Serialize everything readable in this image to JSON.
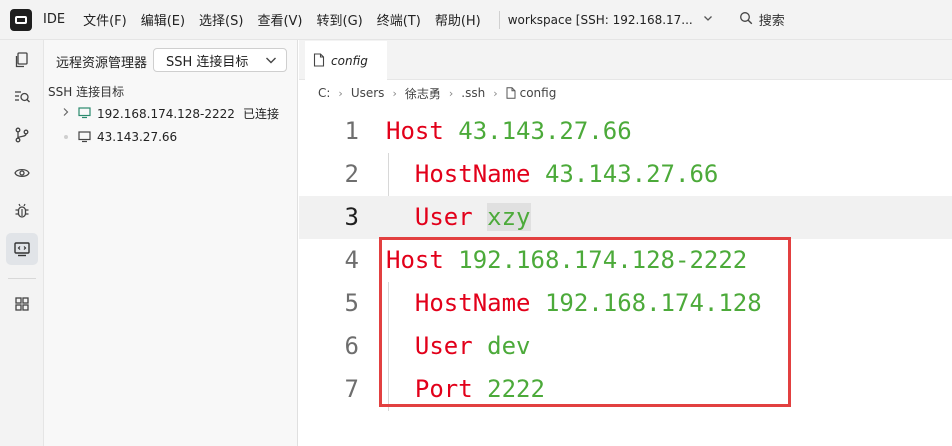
{
  "menubar": {
    "app_name": "IDE",
    "items": [
      "文件(F)",
      "编辑(E)",
      "选择(S)",
      "查看(V)",
      "转到(G)",
      "终端(T)",
      "帮助(H)"
    ],
    "workspace": "workspace [SSH: 192.168.17...",
    "search_label": "搜索"
  },
  "activity_bar": {
    "icons": [
      "explorer-icon",
      "search-icon",
      "source-control-icon",
      "remote-icon",
      "debug-icon",
      "remote-explorer-icon",
      "extensions-icon"
    ],
    "active": "remote-explorer-icon"
  },
  "sidebar": {
    "title": "远程资源管理器",
    "dropdown_value": "SSH 连接目标",
    "section_label": "SSH 连接目标",
    "hosts": [
      {
        "label": "192.168.174.128-2222",
        "status": "已连接"
      },
      {
        "label": "43.143.27.66",
        "status": ""
      }
    ]
  },
  "editor": {
    "tab_label": "config",
    "breadcrumb": [
      "C:",
      "Users",
      "徐志勇",
      ".ssh",
      "config"
    ],
    "lines": [
      {
        "num": "1",
        "key": "Host",
        "value": "43.143.27.66"
      },
      {
        "num": "2",
        "key": "HostName",
        "value": "43.143.27.66"
      },
      {
        "num": "3",
        "key": "User",
        "value": "xzy"
      },
      {
        "num": "4",
        "key": "Host",
        "value": "192.168.174.128-2222"
      },
      {
        "num": "5",
        "key": "HostName",
        "value": "192.168.174.128"
      },
      {
        "num": "6",
        "key": "User",
        "value": "dev"
      },
      {
        "num": "7",
        "key": "Port",
        "value": "2222"
      }
    ],
    "current_line": "3"
  },
  "colors": {
    "keyword": "#e2001a",
    "value": "#4caa3a",
    "annotation_box": "#e24040"
  }
}
